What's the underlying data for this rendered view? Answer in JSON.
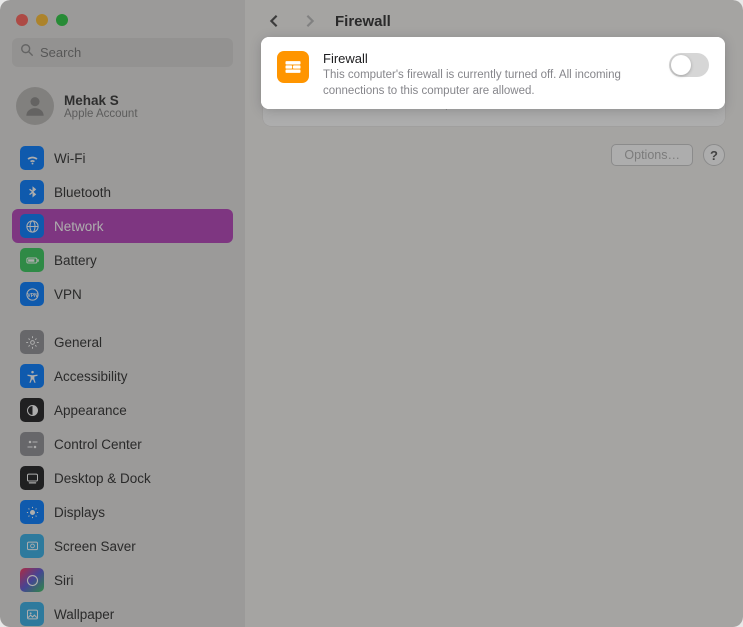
{
  "search": {
    "placeholder": "Search"
  },
  "account": {
    "name": "Mehak S",
    "sub": "Apple Account"
  },
  "sidebar": {
    "groups": [
      [
        {
          "label": "Wi-Fi",
          "color": "ic-blue",
          "icon": "wifi"
        },
        {
          "label": "Bluetooth",
          "color": "ic-blue",
          "icon": "bluetooth"
        },
        {
          "label": "Network",
          "color": "ic-blue",
          "icon": "globe",
          "selected": true
        },
        {
          "label": "Battery",
          "color": "ic-green",
          "icon": "battery"
        },
        {
          "label": "VPN",
          "color": "ic-blue",
          "icon": "vpn"
        }
      ],
      [
        {
          "label": "General",
          "color": "ic-gray",
          "icon": "gear"
        },
        {
          "label": "Accessibility",
          "color": "ic-blue",
          "icon": "accessibility"
        },
        {
          "label": "Appearance",
          "color": "ic-black",
          "icon": "appearance"
        },
        {
          "label": "Control Center",
          "color": "ic-gray",
          "icon": "controlcenter"
        },
        {
          "label": "Desktop & Dock",
          "color": "ic-black",
          "icon": "dock"
        },
        {
          "label": "Displays",
          "color": "ic-blue",
          "icon": "display"
        },
        {
          "label": "Screen Saver",
          "color": "ic-teal",
          "icon": "screensaver"
        },
        {
          "label": "Siri",
          "color": "ic-siri",
          "icon": "siri"
        },
        {
          "label": "Wallpaper",
          "color": "ic-teal",
          "icon": "wallpaper"
        }
      ]
    ]
  },
  "page": {
    "title": "Firewall",
    "card": {
      "title": "Firewall",
      "desc": "This computer's firewall is currently turned off. All incoming connections to this computer are allowed.",
      "toggle_on": false
    },
    "options_label": "Options…",
    "help_label": "?"
  }
}
